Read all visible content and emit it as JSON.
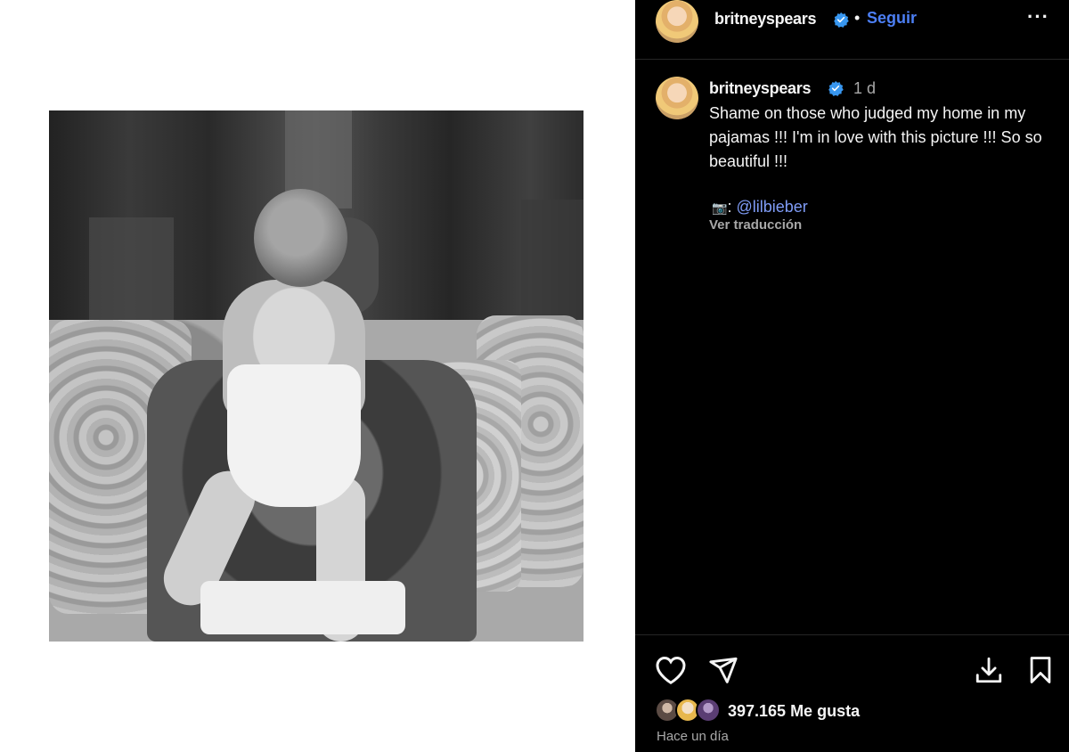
{
  "post": {
    "username": "britneyspears",
    "follow_label": "Seguir",
    "dot": "•",
    "more": "···",
    "time": "1 d",
    "caption": "Shame on those who judged my home in my pajamas !!! I'm in love with this picture !!! So so beautiful !!!",
    "credit_prefix": ":",
    "credit_mention": "@lilbieber",
    "translate_label": "Ver traducción",
    "likes": "397.165 Me gusta",
    "posted_ago": "Hace un día"
  },
  "icons": {
    "verified": "verified-badge-icon",
    "like": "heart-icon",
    "share": "send-icon",
    "download": "download-icon",
    "save": "bookmark-icon",
    "camera": "camera-icon"
  },
  "colors": {
    "panel_bg": "#000000",
    "link_blue": "#4c7ff5",
    "mention_blue": "#7f9cf7",
    "muted": "#a8a8a8"
  }
}
